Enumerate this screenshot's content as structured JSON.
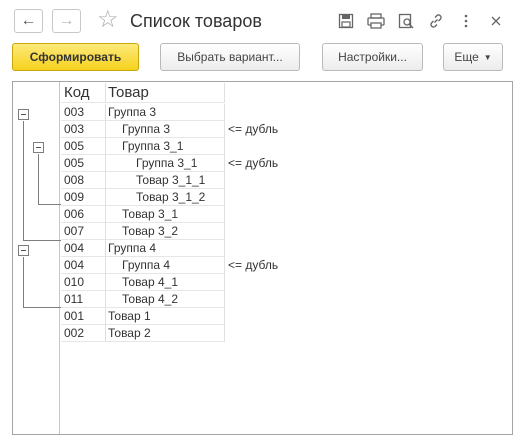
{
  "window": {
    "title": "Список товаров"
  },
  "toolbar": {
    "generate_label": "Сформировать",
    "choose_variant_label": "Выбрать вариант...",
    "settings_label": "Настройки...",
    "more_label": "Еще"
  },
  "report": {
    "headers": {
      "code": "Код",
      "name": "Товар"
    },
    "rows": [
      {
        "code": "003",
        "name": "Группа 3",
        "level": 0,
        "note": ""
      },
      {
        "code": "003",
        "name": "Группа 3",
        "level": 1,
        "note": "<= дубль"
      },
      {
        "code": "005",
        "name": "Группа 3_1",
        "level": 1,
        "note": ""
      },
      {
        "code": "005",
        "name": "Группа 3_1",
        "level": 2,
        "note": "<= дубль"
      },
      {
        "code": "008",
        "name": "Товар 3_1_1",
        "level": 2,
        "note": ""
      },
      {
        "code": "009",
        "name": "Товар 3_1_2",
        "level": 2,
        "note": ""
      },
      {
        "code": "006",
        "name": "Товар 3_1",
        "level": 1,
        "note": ""
      },
      {
        "code": "007",
        "name": "Товар 3_2",
        "level": 1,
        "note": ""
      },
      {
        "code": "004",
        "name": "Группа 4",
        "level": 0,
        "note": ""
      },
      {
        "code": "004",
        "name": "Группа 4",
        "level": 1,
        "note": "<= дубль"
      },
      {
        "code": "010",
        "name": "Товар 4_1",
        "level": 1,
        "note": ""
      },
      {
        "code": "011",
        "name": "Товар 4_2",
        "level": 1,
        "note": ""
      },
      {
        "code": "001",
        "name": "Товар 1",
        "level": 0,
        "note": ""
      },
      {
        "code": "002",
        "name": "Товар 2",
        "level": 0,
        "note": ""
      }
    ]
  },
  "icons": {
    "back": "arrow-left-icon",
    "forward": "arrow-right-icon",
    "favorite": "star-icon",
    "save": "save-icon",
    "print": "print-icon",
    "preview": "print-preview-icon",
    "link": "link-icon",
    "menu": "more-vertical-icon",
    "close": "close-icon"
  },
  "colors": {
    "primary_button": "#f6d21d",
    "tree_lines": "#7d7d7d"
  }
}
